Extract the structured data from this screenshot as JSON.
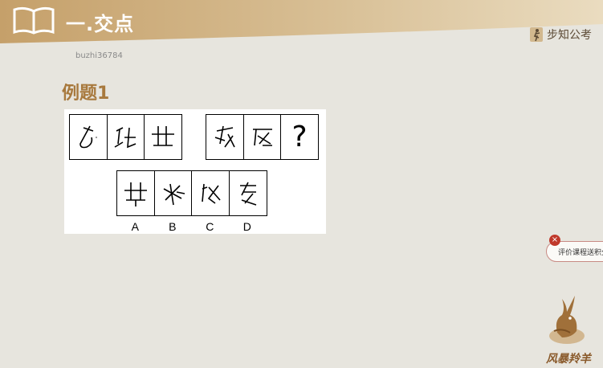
{
  "header": {
    "section_title": "一.交点",
    "brand_name": "步知公考",
    "icons": {
      "book": "open-book-icon",
      "brand": "brand-figure-icon"
    }
  },
  "watermark_id": "buzhi36784",
  "example_title": "例题1",
  "puzzle": {
    "question_mark": "?",
    "option_labels": [
      "A",
      "B",
      "C",
      "D"
    ]
  },
  "rating_button": {
    "label": "评价课程送积分",
    "close_glyph": "×"
  },
  "corner_logo": {
    "caption": "风暴羚羊",
    "icon": "antelope-logo-icon"
  },
  "colors": {
    "header_gradient_start": "#c5a06a",
    "header_gradient_end": "#eadcc0",
    "example_title": "#a8793d",
    "background": "#e7e5de",
    "rating_close": "#c0392b"
  }
}
